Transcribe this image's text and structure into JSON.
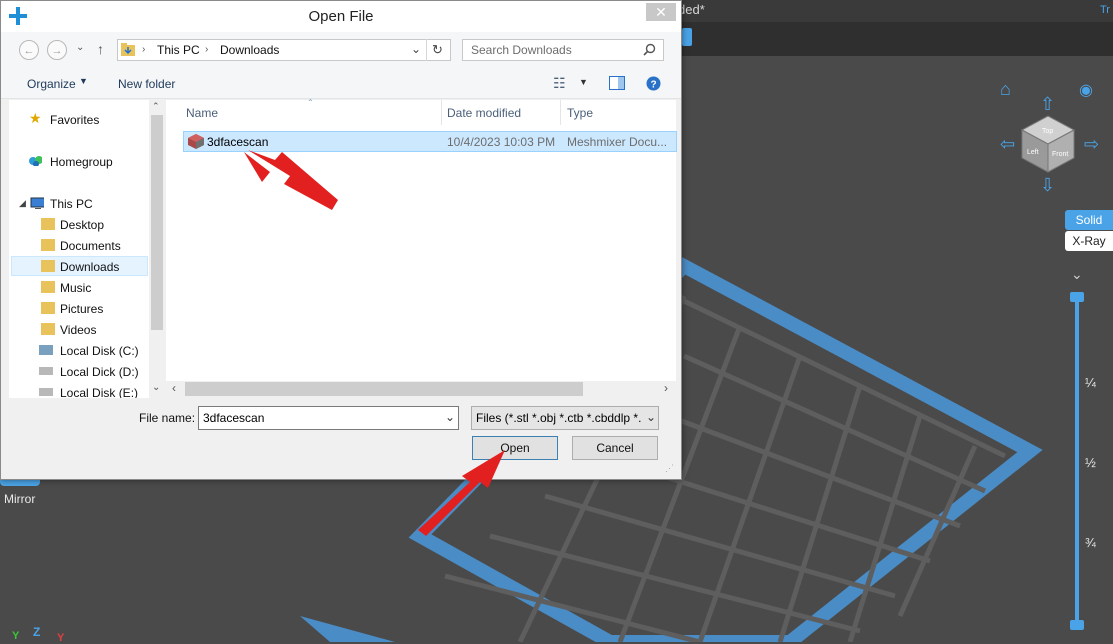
{
  "background_app": {
    "title_fragment": "ded*",
    "top_right_fragment": "Tr",
    "mirror_label": "Mirror",
    "shading_modes": [
      "Solid",
      "X-Ray"
    ],
    "slider_ticks": [
      "¼",
      "½",
      "¾"
    ],
    "view_cube_faces": [
      "Top",
      "Left",
      "Front"
    ],
    "axis_labels": {
      "x": "Y",
      "z": "Z",
      "y": "Y"
    }
  },
  "dialog": {
    "title": "Open File",
    "close_glyph": "✕",
    "breadcrumb": [
      "This PC",
      "Downloads"
    ],
    "search_placeholder": "Search Downloads",
    "organize_label": "Organize",
    "new_folder_label": "New folder",
    "nav_pane": {
      "favorites": "Favorites",
      "homegroup": "Homegroup",
      "this_pc": "This PC",
      "items": [
        "Desktop",
        "Documents",
        "Downloads",
        "Music",
        "Pictures",
        "Videos",
        "Local Disk (C:)",
        "Local Dick (D:)",
        "Local Disk (E:)"
      ],
      "selected": "Downloads"
    },
    "columns": [
      "Name",
      "Date modified",
      "Type"
    ],
    "files": [
      {
        "name": "3dfacescan",
        "date": "10/4/2023 10:03 PM",
        "type": "Meshmixer Docu..."
      }
    ],
    "file_name_label": "File name:",
    "file_name_value": "3dfacescan",
    "file_type_value": "Files (*.stl *.obj *.ctb *.cbddlp *.",
    "open_label": "Open",
    "cancel_label": "Cancel"
  },
  "colors": {
    "accent": "#4aa3e6",
    "arrow": "#e32020",
    "selection": "#cce8ff"
  }
}
